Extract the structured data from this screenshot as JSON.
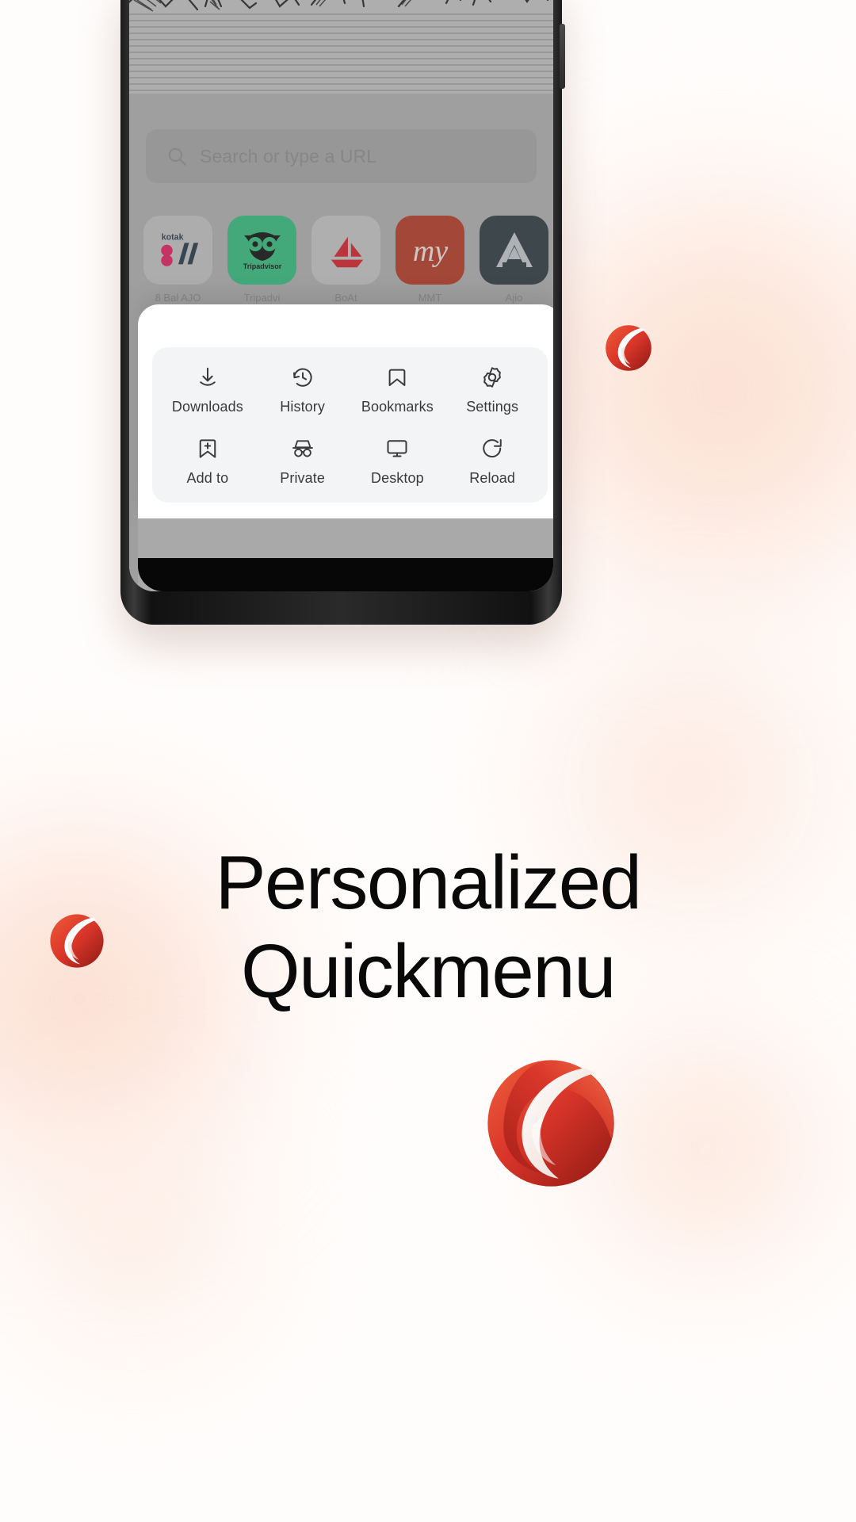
{
  "brand": {
    "name": "Opera",
    "accent": "#d9352a",
    "accent_dark": "#9e1f18",
    "accent_light": "#f0603c"
  },
  "headline": {
    "line1": "Personalized",
    "line2": "Quickmenu"
  },
  "phone": {
    "omnibox": {
      "placeholder": "Search or type a URL",
      "icon": "search-icon"
    },
    "speed_dial": [
      {
        "label": "8 Bal AJO",
        "icon": "kotak-logo"
      },
      {
        "label": "Tripadvi",
        "icon": "tripadvisor-logo"
      },
      {
        "label": "BoAt",
        "icon": "boat-logo"
      },
      {
        "label": "MMT",
        "icon": "makemytrip-logo"
      },
      {
        "label": "Ajio",
        "icon": "ajio-logo"
      }
    ],
    "quickmenu": {
      "items": [
        {
          "label": "Downloads",
          "icon": "download-icon"
        },
        {
          "label": "History",
          "icon": "history-clock-icon"
        },
        {
          "label": "Bookmarks",
          "icon": "bookmark-icon"
        },
        {
          "label": "Settings",
          "icon": "gear-icon"
        },
        {
          "label": "Add to",
          "icon": "add-to-bookmark-icon"
        },
        {
          "label": "Private",
          "icon": "private-incognito-icon"
        },
        {
          "label": "Desktop",
          "icon": "desktop-monitor-icon"
        },
        {
          "label": "Reload",
          "icon": "reload-refresh-icon"
        }
      ]
    }
  }
}
